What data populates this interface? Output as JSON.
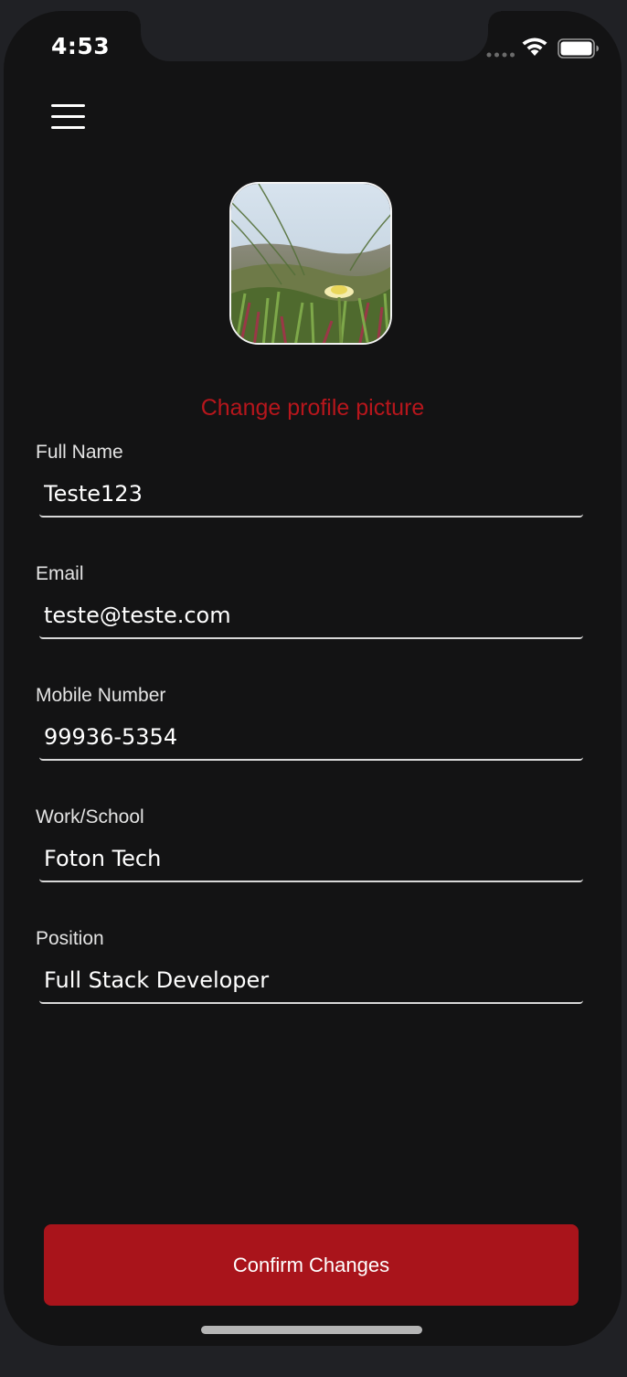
{
  "status_bar": {
    "time": "4:53",
    "signal_icon": "signal-dots-icon",
    "wifi_icon": "wifi-icon",
    "battery_icon": "battery-full-icon"
  },
  "header": {
    "menu_icon": "hamburger-menu-icon"
  },
  "profile": {
    "change_picture_label": "Change profile picture"
  },
  "form": {
    "fields": [
      {
        "label": "Full Name",
        "value": "Teste123"
      },
      {
        "label": "Email",
        "value": "teste@teste.com"
      },
      {
        "label": "Mobile Number",
        "value": "99936-5354"
      },
      {
        "label": "Work/School",
        "value": "Foton Tech"
      },
      {
        "label": "Position",
        "value": "Full Stack Developer"
      }
    ],
    "confirm_label": "Confirm Changes"
  },
  "colors": {
    "accent": "#a9141b",
    "link": "#b7161c",
    "background": "#131314",
    "text": "#ffffff"
  }
}
